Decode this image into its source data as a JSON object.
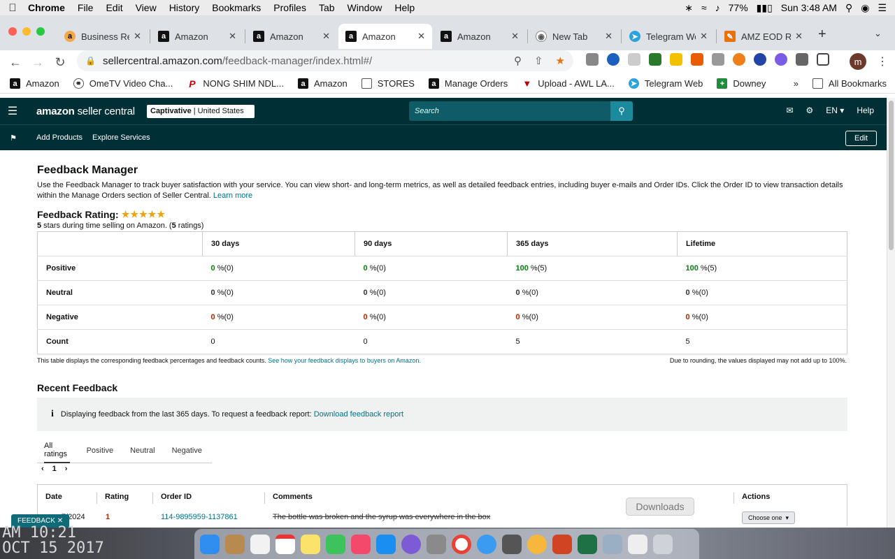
{
  "menubar": {
    "app": "Chrome",
    "items": [
      "File",
      "Edit",
      "View",
      "History",
      "Bookmarks",
      "Profiles",
      "Tab",
      "Window",
      "Help"
    ],
    "battery": "77%",
    "clock": "Sun 3:48 AM"
  },
  "tabs": [
    {
      "title": "Business Re",
      "active": false
    },
    {
      "title": "Amazon",
      "active": false
    },
    {
      "title": "Amazon",
      "active": false
    },
    {
      "title": "Amazon",
      "active": true
    },
    {
      "title": "Amazon",
      "active": false
    },
    {
      "title": "New Tab",
      "active": false
    },
    {
      "title": "Telegram We",
      "active": false
    },
    {
      "title": "AMZ EOD Re",
      "active": false
    }
  ],
  "address": {
    "host": "sellercentral.amazon.com",
    "path": "/feedback-manager/index.html#/"
  },
  "profile_initial": "m",
  "bookmarks": [
    "Amazon",
    "OmeTV Video Cha...",
    "NONG SHIM NDL...",
    "Amazon",
    "STORES",
    "Manage Orders",
    "Upload - AWL LA...",
    "Telegram Web",
    "Downey"
  ],
  "bookmarks_all": "All Bookmarks",
  "sc": {
    "logo_brand": "amazon",
    "logo_rest": " seller central",
    "account_name": "Captivative",
    "account_region": " | United States",
    "search_placeholder": "Search",
    "lang": "EN",
    "help": "Help",
    "nav": [
      "Add Products",
      "Explore Services"
    ],
    "edit": "Edit"
  },
  "page": {
    "title": "Feedback Manager",
    "intro": "Use the Feedback Manager to track buyer satisfaction with your service. You can view short- and long-term metrics, as well as detailed feedback entries, including buyer e-mails and Order IDs. Click the Order ID to view transaction details within the Manage Orders section of Seller Central.",
    "learn_more": "Learn more",
    "rating_label": "Feedback Rating:",
    "stars": 5,
    "rating_sub_stars": "5",
    "rating_sub_mid": " stars during time selling on Amazon. (",
    "rating_sub_count": "5",
    "rating_sub_end": " ratings)"
  },
  "feedback_table": {
    "columns": [
      "30 days",
      "90 days",
      "365 days",
      "Lifetime"
    ],
    "rows": [
      {
        "label": "Positive",
        "values": [
          "0",
          "0",
          "100",
          "100"
        ],
        "counts": [
          "%(0)",
          "%(0)",
          "%(5)",
          "%(5)"
        ]
      },
      {
        "label": "Neutral",
        "values": [
          "0",
          "0",
          "0",
          "0"
        ],
        "counts": [
          "%(0)",
          "%(0)",
          "%(0)",
          "%(0)"
        ]
      },
      {
        "label": "Negative",
        "values": [
          "0",
          "0",
          "0",
          "0"
        ],
        "counts": [
          "%(0)",
          "%(0)",
          "%(0)",
          "%(0)"
        ]
      },
      {
        "label": "Count",
        "values": [
          "0",
          "0",
          "5",
          "5"
        ]
      }
    ],
    "note": "This table displays the corresponding feedback percentages and feedback counts.",
    "note_link": "See how your feedback displays to buyers on Amazon.",
    "rounding_note": "Due to rounding, the values displayed may not add up to 100%."
  },
  "recent": {
    "title": "Recent Feedback",
    "info": "Displaying feedback from the last 365 days. To request a feedback report:",
    "info_link": "Download feedback report",
    "filter_tabs": [
      "All ratings",
      "Positive",
      "Neutral",
      "Negative"
    ],
    "page": "1",
    "columns": [
      "Date",
      "Rating",
      "Order ID",
      "Comments",
      "Actions"
    ],
    "row": {
      "date": "7/2024",
      "rating": "1",
      "order_id": "114-9895959-1137861",
      "comment": "The bottle was broken and the syrup was everywhere in the box",
      "action": "Choose one"
    }
  },
  "feedback_tab": "FEEDBACK",
  "downloads_tooltip": "Downloads",
  "desktop_clock": [
    "AM 10:21",
    "OCT 15 2017"
  ]
}
